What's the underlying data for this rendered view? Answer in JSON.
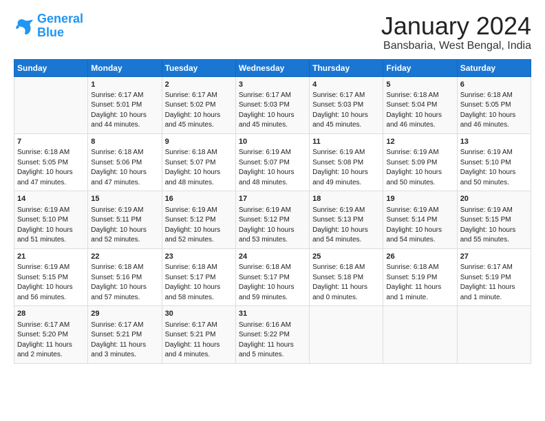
{
  "logo": {
    "line1": "General",
    "line2": "Blue"
  },
  "title": "January 2024",
  "subtitle": "Bansbaria, West Bengal, India",
  "headers": [
    "Sunday",
    "Monday",
    "Tuesday",
    "Wednesday",
    "Thursday",
    "Friday",
    "Saturday"
  ],
  "weeks": [
    [
      {
        "day": "",
        "content": ""
      },
      {
        "day": "1",
        "content": "Sunrise: 6:17 AM\nSunset: 5:01 PM\nDaylight: 10 hours\nand 44 minutes."
      },
      {
        "day": "2",
        "content": "Sunrise: 6:17 AM\nSunset: 5:02 PM\nDaylight: 10 hours\nand 45 minutes."
      },
      {
        "day": "3",
        "content": "Sunrise: 6:17 AM\nSunset: 5:03 PM\nDaylight: 10 hours\nand 45 minutes."
      },
      {
        "day": "4",
        "content": "Sunrise: 6:17 AM\nSunset: 5:03 PM\nDaylight: 10 hours\nand 45 minutes."
      },
      {
        "day": "5",
        "content": "Sunrise: 6:18 AM\nSunset: 5:04 PM\nDaylight: 10 hours\nand 46 minutes."
      },
      {
        "day": "6",
        "content": "Sunrise: 6:18 AM\nSunset: 5:05 PM\nDaylight: 10 hours\nand 46 minutes."
      }
    ],
    [
      {
        "day": "7",
        "content": "Sunrise: 6:18 AM\nSunset: 5:05 PM\nDaylight: 10 hours\nand 47 minutes."
      },
      {
        "day": "8",
        "content": "Sunrise: 6:18 AM\nSunset: 5:06 PM\nDaylight: 10 hours\nand 47 minutes."
      },
      {
        "day": "9",
        "content": "Sunrise: 6:18 AM\nSunset: 5:07 PM\nDaylight: 10 hours\nand 48 minutes."
      },
      {
        "day": "10",
        "content": "Sunrise: 6:19 AM\nSunset: 5:07 PM\nDaylight: 10 hours\nand 48 minutes."
      },
      {
        "day": "11",
        "content": "Sunrise: 6:19 AM\nSunset: 5:08 PM\nDaylight: 10 hours\nand 49 minutes."
      },
      {
        "day": "12",
        "content": "Sunrise: 6:19 AM\nSunset: 5:09 PM\nDaylight: 10 hours\nand 50 minutes."
      },
      {
        "day": "13",
        "content": "Sunrise: 6:19 AM\nSunset: 5:10 PM\nDaylight: 10 hours\nand 50 minutes."
      }
    ],
    [
      {
        "day": "14",
        "content": "Sunrise: 6:19 AM\nSunset: 5:10 PM\nDaylight: 10 hours\nand 51 minutes."
      },
      {
        "day": "15",
        "content": "Sunrise: 6:19 AM\nSunset: 5:11 PM\nDaylight: 10 hours\nand 52 minutes."
      },
      {
        "day": "16",
        "content": "Sunrise: 6:19 AM\nSunset: 5:12 PM\nDaylight: 10 hours\nand 52 minutes."
      },
      {
        "day": "17",
        "content": "Sunrise: 6:19 AM\nSunset: 5:12 PM\nDaylight: 10 hours\nand 53 minutes."
      },
      {
        "day": "18",
        "content": "Sunrise: 6:19 AM\nSunset: 5:13 PM\nDaylight: 10 hours\nand 54 minutes."
      },
      {
        "day": "19",
        "content": "Sunrise: 6:19 AM\nSunset: 5:14 PM\nDaylight: 10 hours\nand 54 minutes."
      },
      {
        "day": "20",
        "content": "Sunrise: 6:19 AM\nSunset: 5:15 PM\nDaylight: 10 hours\nand 55 minutes."
      }
    ],
    [
      {
        "day": "21",
        "content": "Sunrise: 6:19 AM\nSunset: 5:15 PM\nDaylight: 10 hours\nand 56 minutes."
      },
      {
        "day": "22",
        "content": "Sunrise: 6:18 AM\nSunset: 5:16 PM\nDaylight: 10 hours\nand 57 minutes."
      },
      {
        "day": "23",
        "content": "Sunrise: 6:18 AM\nSunset: 5:17 PM\nDaylight: 10 hours\nand 58 minutes."
      },
      {
        "day": "24",
        "content": "Sunrise: 6:18 AM\nSunset: 5:17 PM\nDaylight: 10 hours\nand 59 minutes."
      },
      {
        "day": "25",
        "content": "Sunrise: 6:18 AM\nSunset: 5:18 PM\nDaylight: 11 hours\nand 0 minutes."
      },
      {
        "day": "26",
        "content": "Sunrise: 6:18 AM\nSunset: 5:19 PM\nDaylight: 11 hours\nand 1 minute."
      },
      {
        "day": "27",
        "content": "Sunrise: 6:17 AM\nSunset: 5:19 PM\nDaylight: 11 hours\nand 1 minute."
      }
    ],
    [
      {
        "day": "28",
        "content": "Sunrise: 6:17 AM\nSunset: 5:20 PM\nDaylight: 11 hours\nand 2 minutes."
      },
      {
        "day": "29",
        "content": "Sunrise: 6:17 AM\nSunset: 5:21 PM\nDaylight: 11 hours\nand 3 minutes."
      },
      {
        "day": "30",
        "content": "Sunrise: 6:17 AM\nSunset: 5:21 PM\nDaylight: 11 hours\nand 4 minutes."
      },
      {
        "day": "31",
        "content": "Sunrise: 6:16 AM\nSunset: 5:22 PM\nDaylight: 11 hours\nand 5 minutes."
      },
      {
        "day": "",
        "content": ""
      },
      {
        "day": "",
        "content": ""
      },
      {
        "day": "",
        "content": ""
      }
    ]
  ]
}
